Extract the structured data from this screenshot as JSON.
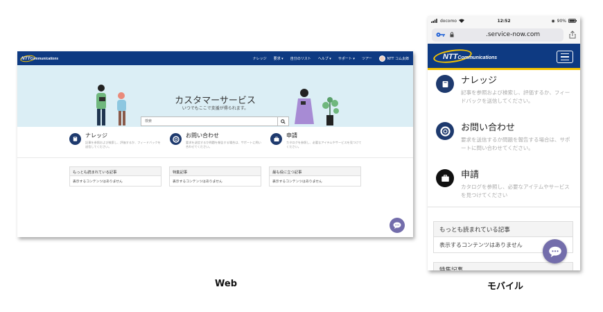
{
  "web": {
    "logo": {
      "main": "NTT",
      "sub": "Communications"
    },
    "nav": [
      "ナレッジ",
      "要求 ▾",
      "自分のリスト",
      "ヘルプ ▾",
      "サポート ▾",
      "ツアー"
    ],
    "user_name": "NTT コム太郎",
    "hero": {
      "title": "カスタマーサービス",
      "subtitle": "いつでもここで支援が得られます。",
      "search_placeholder": "検索"
    },
    "cards": [
      {
        "title": "ナレッジ",
        "desc": "記事を参照および検索し、評価するか、フィードバックを送信してください。",
        "icon": "book-icon"
      },
      {
        "title": "お問い合わせ",
        "desc": "要求を送信するか問題を報告する場合は、サポートに問い合わせてください。",
        "icon": "lifebuoy-icon"
      },
      {
        "title": "申請",
        "desc": "カタログを参照し、必要なアイテムやサービスを見つけてください。",
        "icon": "briefcase-icon"
      }
    ],
    "panels": [
      {
        "title": "もっとも読まれている記事",
        "body": "表示するコンテンツはありません"
      },
      {
        "title": "特集記事",
        "body": "表示するコンテンツはありません"
      },
      {
        "title": "最も役に立つ記事",
        "body": "表示するコンテンツはありません"
      }
    ]
  },
  "mobile": {
    "status": {
      "carrier": "docomo",
      "time": "12:52",
      "battery": "90%"
    },
    "url": ".service-now.com",
    "logo": {
      "main": "NTT",
      "sub": "Communications"
    },
    "items": [
      {
        "title": "ナレッジ",
        "desc": "記事を参照および検索し、評価するか、フィードバックを送信してください。",
        "icon": "book-icon"
      },
      {
        "title": "お問い合わせ",
        "desc": "要求を送信するか問題を報告する場合は、サポートに問い合わせてください。",
        "icon": "lifebuoy-icon"
      },
      {
        "title": "申請",
        "desc": "カタログを参照し、必要なアイテムやサービスを見つけてください",
        "icon": "briefcase-icon"
      }
    ],
    "panel": {
      "title": "もっとも読まれている記事",
      "body": "表示するコンテンツはありません"
    },
    "panel2_title": "特集記事"
  },
  "captions": {
    "web": "Web",
    "mobile": "モバイル"
  },
  "colors": {
    "nav": "#0e3a82",
    "accent": "#f5c400",
    "chat": "#736dab",
    "hero": "#dbeef5",
    "icon_bg": "#1e3a6e"
  }
}
